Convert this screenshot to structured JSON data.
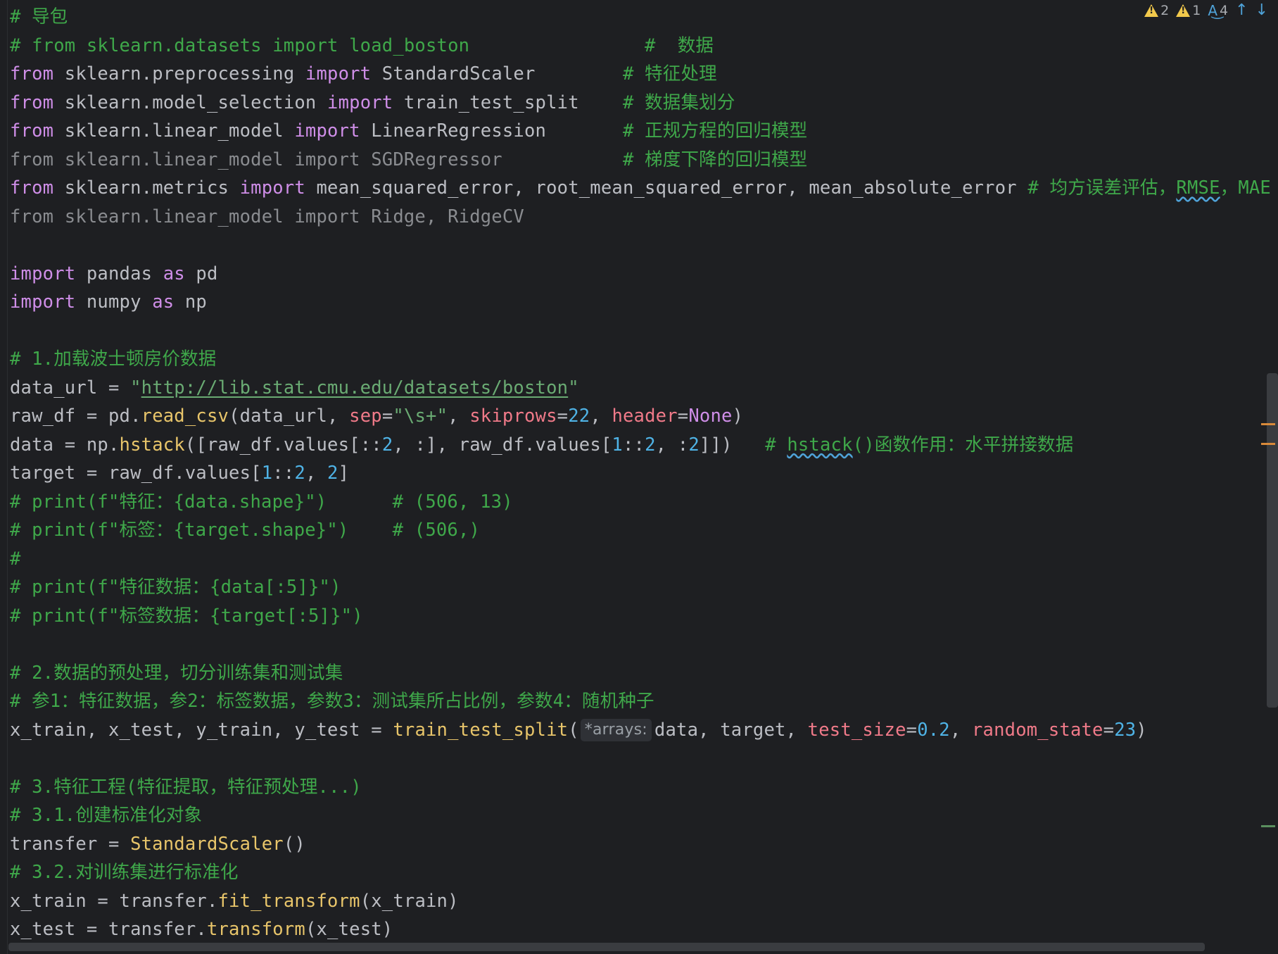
{
  "editor": {
    "status": {
      "warnings_strong": "2",
      "warnings_weak": "1",
      "typos": "4",
      "prev_label": "↑",
      "next_label": "↓",
      "colors": {
        "warning": "#f2c94c",
        "typo": "#4fa3d9"
      }
    },
    "lines": [
      [
        {
          "t": "# 导包",
          "c": "com"
        }
      ],
      [
        {
          "t": "# from sklearn.datasets import load_boston                #  数据",
          "c": "com"
        }
      ],
      [
        {
          "t": "from",
          "c": "kw"
        },
        {
          "t": " sklearn.preprocessing ",
          "c": ""
        },
        {
          "t": "import",
          "c": "kw"
        },
        {
          "t": " StandardScaler        ",
          "c": ""
        },
        {
          "t": "# 特征处理",
          "c": "com"
        }
      ],
      [
        {
          "t": "from",
          "c": "kw"
        },
        {
          "t": " sklearn.model_selection ",
          "c": ""
        },
        {
          "t": "import",
          "c": "kw"
        },
        {
          "t": " train_test_split    ",
          "c": ""
        },
        {
          "t": "# 数据集划分",
          "c": "com"
        }
      ],
      [
        {
          "t": "from",
          "c": "kw"
        },
        {
          "t": " sklearn.linear_model ",
          "c": ""
        },
        {
          "t": "import",
          "c": "kw"
        },
        {
          "t": " LinearRegression       ",
          "c": ""
        },
        {
          "t": "# 正规方程的回归模型",
          "c": "com"
        }
      ],
      [
        {
          "t": "from sklearn.linear_model import SGDRegressor           ",
          "c": "dim"
        },
        {
          "t": "# 梯度下降的回归模型",
          "c": "com"
        }
      ],
      [
        {
          "t": "from",
          "c": "kw"
        },
        {
          "t": " sklearn.metrics ",
          "c": ""
        },
        {
          "t": "import",
          "c": "kw"
        },
        {
          "t": " mean_squared_error, root_mean_squared_error, mean_absolute_error ",
          "c": ""
        },
        {
          "t": "# 均方误差评估，",
          "c": "com"
        },
        {
          "t": "RMSE",
          "c": "com wavy"
        },
        {
          "t": "，MAE",
          "c": "com"
        }
      ],
      [
        {
          "t": "from sklearn.linear_model import Ridge, RidgeCV",
          "c": "dim"
        }
      ],
      [
        {
          "t": "",
          "c": ""
        }
      ],
      [
        {
          "t": "import",
          "c": "kw"
        },
        {
          "t": " pandas ",
          "c": ""
        },
        {
          "t": "as",
          "c": "kw"
        },
        {
          "t": " pd",
          "c": ""
        }
      ],
      [
        {
          "t": "import",
          "c": "kw"
        },
        {
          "t": " numpy ",
          "c": ""
        },
        {
          "t": "as",
          "c": "kw"
        },
        {
          "t": " np",
          "c": ""
        }
      ],
      [
        {
          "t": "",
          "c": ""
        }
      ],
      [
        {
          "t": "# 1.加载波士顿房价数据",
          "c": "com"
        }
      ],
      [
        {
          "t": "data_url = ",
          "c": ""
        },
        {
          "t": "\"",
          "c": "str"
        },
        {
          "t": "http://lib.stat.cmu.edu/datasets/boston",
          "c": "str uline"
        },
        {
          "t": "\"",
          "c": "str"
        }
      ],
      [
        {
          "t": "raw_df = pd.",
          "c": ""
        },
        {
          "t": "read_csv",
          "c": "fn"
        },
        {
          "t": "(data_url, ",
          "c": ""
        },
        {
          "t": "sep",
          "c": "param"
        },
        {
          "t": "=",
          "c": ""
        },
        {
          "t": "\"\\s+\"",
          "c": "str"
        },
        {
          "t": ", ",
          "c": ""
        },
        {
          "t": "skiprows",
          "c": "param"
        },
        {
          "t": "=",
          "c": ""
        },
        {
          "t": "22",
          "c": "num"
        },
        {
          "t": ", ",
          "c": ""
        },
        {
          "t": "header",
          "c": "param"
        },
        {
          "t": "=",
          "c": ""
        },
        {
          "t": "None",
          "c": "kw"
        },
        {
          "t": ")",
          "c": ""
        }
      ],
      [
        {
          "t": "data = np.",
          "c": ""
        },
        {
          "t": "hstack",
          "c": "fn"
        },
        {
          "t": "([raw_df.values[::",
          "c": ""
        },
        {
          "t": "2",
          "c": "num"
        },
        {
          "t": ", :], raw_df.values[",
          "c": ""
        },
        {
          "t": "1",
          "c": "num"
        },
        {
          "t": "::",
          "c": ""
        },
        {
          "t": "2",
          "c": "num"
        },
        {
          "t": ", :",
          "c": ""
        },
        {
          "t": "2",
          "c": "num"
        },
        {
          "t": "]])   ",
          "c": ""
        },
        {
          "t": "# ",
          "c": "com"
        },
        {
          "t": "hstack",
          "c": "com wavy"
        },
        {
          "t": "()函数作用：水平拼接数据",
          "c": "com"
        }
      ],
      [
        {
          "t": "target = raw_df.values[",
          "c": ""
        },
        {
          "t": "1",
          "c": "num"
        },
        {
          "t": "::",
          "c": ""
        },
        {
          "t": "2",
          "c": "num"
        },
        {
          "t": ", ",
          "c": ""
        },
        {
          "t": "2",
          "c": "num"
        },
        {
          "t": "]",
          "c": ""
        }
      ],
      [
        {
          "t": "# print(f\"特征：{data.shape}\")      # (506, 13)",
          "c": "com"
        }
      ],
      [
        {
          "t": "# print(f\"标签：{target.shape}\")    # (506,)",
          "c": "com"
        }
      ],
      [
        {
          "t": "#",
          "c": "com"
        }
      ],
      [
        {
          "t": "# print(f\"特征数据：{data[:5]}\")",
          "c": "com"
        }
      ],
      [
        {
          "t": "# print(f\"标签数据：{target[:5]}\")",
          "c": "com"
        }
      ],
      [
        {
          "t": "",
          "c": ""
        }
      ],
      [
        {
          "t": "# 2.数据的预处理，切分训练集和测试集",
          "c": "com"
        }
      ],
      [
        {
          "t": "# 参1：特征数据，参2：标签数据，参数3：测试集所占比例，参数4：随机种子",
          "c": "com"
        }
      ],
      [
        {
          "t": "x_train, x_test, y_train, y_test = ",
          "c": ""
        },
        {
          "t": "train_test_split",
          "c": "fn"
        },
        {
          "t": "(",
          "c": ""
        },
        {
          "t": "*arrays:",
          "c": "hint"
        },
        {
          "t": "data, target, ",
          "c": ""
        },
        {
          "t": "test_size",
          "c": "param"
        },
        {
          "t": "=",
          "c": ""
        },
        {
          "t": "0.2",
          "c": "num"
        },
        {
          "t": ", ",
          "c": ""
        },
        {
          "t": "random_state",
          "c": "param"
        },
        {
          "t": "=",
          "c": ""
        },
        {
          "t": "23",
          "c": "num"
        },
        {
          "t": ")",
          "c": ""
        }
      ],
      [
        {
          "t": "",
          "c": ""
        }
      ],
      [
        {
          "t": "# 3.特征工程(特征提取，特征预处理...)",
          "c": "com"
        }
      ],
      [
        {
          "t": "# 3.1.创建标准化对象",
          "c": "com"
        }
      ],
      [
        {
          "t": "transfer = ",
          "c": ""
        },
        {
          "t": "StandardScaler",
          "c": "fn"
        },
        {
          "t": "()",
          "c": ""
        }
      ],
      [
        {
          "t": "# 3.2.对训练集进行标准化",
          "c": "com"
        }
      ],
      [
        {
          "t": "x_train = transfer.",
          "c": ""
        },
        {
          "t": "fit_transform",
          "c": "fn"
        },
        {
          "t": "(x_train)",
          "c": ""
        }
      ],
      [
        {
          "t": "x_test = transfer.",
          "c": ""
        },
        {
          "t": "transform",
          "c": "fn"
        },
        {
          "t": "(x_test)",
          "c": ""
        }
      ]
    ]
  }
}
